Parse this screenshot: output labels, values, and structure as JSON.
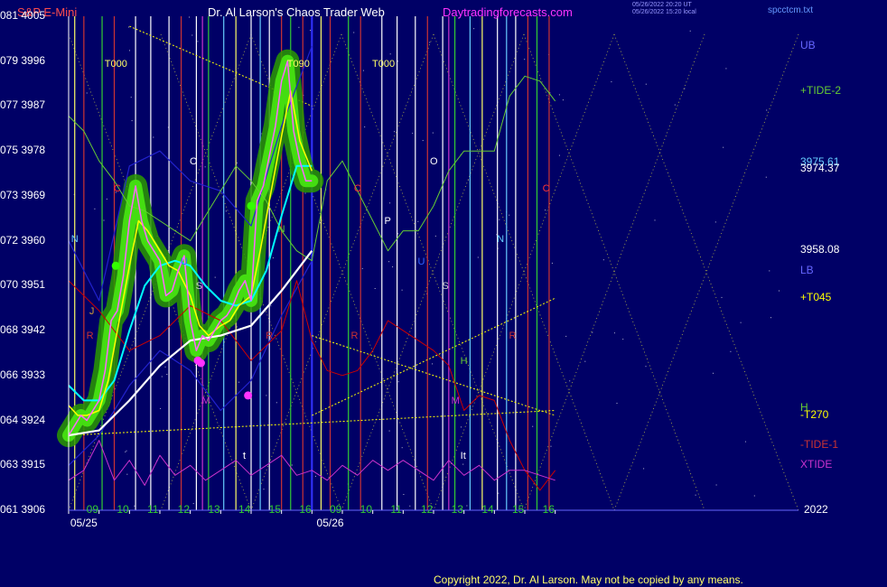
{
  "header": {
    "ticker": "S&P E-Mini",
    "title": "Dr. Al Larson's Chaos Trader Web",
    "url": "Daytradingforecasts.com",
    "timestamp_ut": "05/26/2022 20:20 UT",
    "timestamp_local": "05/26/2022 15:20 local",
    "filename": "spcctcm.txt"
  },
  "footer": {
    "copyright": "Copyright 2022, Dr. Al Larson. May not be copied by any means."
  },
  "colors": {
    "background": "#000066",
    "price": "#ff66ff",
    "fast_ma": "#ffff00",
    "mid_ma": "#00ffff",
    "slow_ma": "#ffffff",
    "green_band": "#33cc00",
    "tide2": "#66cc33",
    "tide1": "#cc0000",
    "xtide": "#cc33cc"
  },
  "chart_data": {
    "type": "line",
    "title": "S&P E-Mini",
    "y_axis": {
      "ylim": [
        3906,
        4005
      ],
      "ticks": [
        {
          "left": "061",
          "value": 3906
        },
        {
          "left": "063",
          "value": 3915
        },
        {
          "left": "064",
          "value": 3924
        },
        {
          "left": "066",
          "value": 3933
        },
        {
          "left": "068",
          "value": 3942
        },
        {
          "left": "070",
          "value": 3951
        },
        {
          "left": "072",
          "value": 3960
        },
        {
          "left": "073",
          "value": 3969
        },
        {
          "left": "075",
          "value": 3978
        },
        {
          "left": "077",
          "value": 3987
        },
        {
          "left": "079",
          "value": 3996
        },
        {
          "left": "081",
          "value": 4005
        }
      ]
    },
    "x_axis": {
      "xlim": [
        8.0,
        32.0
      ],
      "hour_ticks": [
        {
          "t": 9,
          "label": "09"
        },
        {
          "t": 10,
          "label": "10"
        },
        {
          "t": 11,
          "label": "11"
        },
        {
          "t": 12,
          "label": "12"
        },
        {
          "t": 13,
          "label": "13"
        },
        {
          "t": 14,
          "label": "14"
        },
        {
          "t": 15,
          "label": "15"
        },
        {
          "t": 16,
          "label": "16"
        },
        {
          "t": 17,
          "label": "09"
        },
        {
          "t": 18,
          "label": "10"
        },
        {
          "t": 19,
          "label": "11"
        },
        {
          "t": 20,
          "label": "12"
        },
        {
          "t": 21,
          "label": "13"
        },
        {
          "t": 22,
          "label": "14"
        },
        {
          "t": 23,
          "label": "15"
        },
        {
          "t": 24,
          "label": "16"
        }
      ],
      "date_labels": [
        {
          "t": 8.5,
          "label": "05/25"
        },
        {
          "t": 16.6,
          "label": "05/26"
        }
      ],
      "year_label": "2022"
    },
    "right_labels": [
      {
        "text": "UB",
        "y": 3999,
        "color": "#6666ff"
      },
      {
        "text": "+TIDE-2",
        "y": 3990,
        "color": "#66cc33"
      },
      {
        "text": "3975.61",
        "y": 3975.6,
        "color": "#66ccff"
      },
      {
        "text": "3974.37",
        "y": 3974.4,
        "color": "#ffffff"
      },
      {
        "text": "3958.08",
        "y": 3958.1,
        "color": "#ffffff"
      },
      {
        "text": "LB",
        "y": 3954,
        "color": "#6666ff"
      },
      {
        "text": "+T045",
        "y": 3948.5,
        "color": "#ffff00"
      },
      {
        "text": "H",
        "y": 3926.5,
        "color": "#66cc33"
      },
      {
        "text": "-T270",
        "y": 3925.0,
        "color": "#ffff00"
      },
      {
        "text": "-TIDE-1",
        "y": 3919,
        "color": "#cc3333"
      },
      {
        "text": "XTIDE",
        "y": 3915,
        "color": "#cc33cc"
      }
    ],
    "point_labels": [
      {
        "text": "T000",
        "t": 9.3,
        "y": 3995,
        "color": "#ffff66"
      },
      {
        "text": "T090",
        "t": 15.3,
        "y": 3995,
        "color": "#ffff66"
      },
      {
        "text": "T000",
        "t": 18.1,
        "y": 3995,
        "color": "#ffff66"
      },
      {
        "text": "O",
        "t": 12.1,
        "y": 3975.5,
        "color": "#ffffff"
      },
      {
        "text": "O",
        "t": 20.0,
        "y": 3975.5,
        "color": "#ffffff"
      },
      {
        "text": "C",
        "t": 9.6,
        "y": 3970,
        "color": "#ff3333"
      },
      {
        "text": "C",
        "t": 17.5,
        "y": 3970,
        "color": "#ff3333"
      },
      {
        "text": "C",
        "t": 23.7,
        "y": 3970,
        "color": "#ff3333"
      },
      {
        "text": "P",
        "t": 18.5,
        "y": 3963.5,
        "color": "#ffffff"
      },
      {
        "text": "N",
        "t": 8.2,
        "y": 3960,
        "color": "#66ccff"
      },
      {
        "text": "N",
        "t": 22.2,
        "y": 3960,
        "color": "#66ccff"
      },
      {
        "text": "N",
        "t": 15.0,
        "y": 3962,
        "color": "#66cc33"
      },
      {
        "text": "U",
        "t": 11.8,
        "y": 3955.5,
        "color": "#3366ff"
      },
      {
        "text": "U",
        "t": 19.6,
        "y": 3955.5,
        "color": "#3366ff"
      },
      {
        "text": "S",
        "t": 12.3,
        "y": 3950.5,
        "color": "#cccccc"
      },
      {
        "text": "S",
        "t": 20.4,
        "y": 3950.5,
        "color": "#cccccc"
      },
      {
        "text": "J",
        "t": 8.8,
        "y": 3945.5,
        "color": "#cc9933"
      },
      {
        "text": "R",
        "t": 8.7,
        "y": 3940.5,
        "color": "#cc3333"
      },
      {
        "text": "R",
        "t": 14.6,
        "y": 3940.5,
        "color": "#cc3333"
      },
      {
        "text": "R",
        "t": 17.4,
        "y": 3940.5,
        "color": "#cc3333"
      },
      {
        "text": "R",
        "t": 22.6,
        "y": 3940.5,
        "color": "#cc3333"
      },
      {
        "text": "H",
        "t": 21.0,
        "y": 3935.5,
        "color": "#66cc33"
      },
      {
        "text": "M",
        "t": 12.5,
        "y": 3927.5,
        "color": "#cc33cc"
      },
      {
        "text": "M",
        "t": 20.7,
        "y": 3927.5,
        "color": "#cc33cc"
      },
      {
        "text": "t",
        "t": 13.85,
        "y": 3916.5,
        "color": "#ffffff"
      },
      {
        "text": "It",
        "t": 21.0,
        "y": 3916.5,
        "color": "#ffffff"
      }
    ],
    "series": [
      {
        "name": "price",
        "color": "#ff66ff",
        "x": [
          8.0,
          8.2,
          8.4,
          8.6,
          8.8,
          9.0,
          9.2,
          9.4,
          9.6,
          9.8,
          10.0,
          10.2,
          10.4,
          10.6,
          10.8,
          11.0,
          11.2,
          11.4,
          11.6,
          11.8,
          12.0,
          12.2,
          12.4,
          12.6,
          12.8,
          13.0,
          13.2,
          13.4,
          13.6,
          13.8,
          14.0,
          14.2,
          14.4,
          14.6,
          14.8,
          15.0,
          15.2,
          15.4,
          15.6,
          15.8,
          16.0
        ],
        "y": [
          3921,
          3923,
          3925,
          3924,
          3926,
          3928,
          3934,
          3944,
          3946,
          3953,
          3964,
          3971,
          3964,
          3960,
          3958,
          3956,
          3949,
          3950,
          3954,
          3957,
          3944,
          3938,
          3941,
          3940,
          3942,
          3944,
          3945,
          3947,
          3950,
          3952,
          3948,
          3968,
          3971,
          3977,
          3983,
          3992,
          3996,
          3982,
          3976,
          3972,
          3972
        ]
      },
      {
        "name": "fast-ma",
        "color": "#ffff00",
        "x": [
          8.0,
          8.3,
          8.6,
          9.0,
          9.3,
          9.6,
          10.0,
          10.3,
          10.6,
          11.0,
          11.3,
          11.6,
          12.0,
          12.3,
          12.6,
          13.0,
          13.3,
          13.6,
          14.0,
          14.3,
          14.6,
          15.0,
          15.3,
          15.6,
          16.0
        ],
        "y": [
          3927,
          3925,
          3925,
          3926,
          3932,
          3942,
          3955,
          3964,
          3962,
          3958,
          3955,
          3954,
          3949,
          3943,
          3941,
          3943,
          3944,
          3947,
          3949,
          3958,
          3968,
          3981,
          3990,
          3980,
          3974
        ]
      },
      {
        "name": "mid-ma",
        "color": "#00ffff",
        "x": [
          8.0,
          8.5,
          9.0,
          9.5,
          10.0,
          10.5,
          11.0,
          11.5,
          12.0,
          12.5,
          13.0,
          13.5,
          14.0,
          14.5,
          15.0,
          15.5,
          16.0
        ],
        "y": [
          3931,
          3928,
          3928,
          3932,
          3942,
          3951,
          3955,
          3956,
          3955,
          3951,
          3948,
          3947,
          3948,
          3954,
          3965,
          3975,
          3975
        ]
      },
      {
        "name": "slow-ma",
        "color": "#ffffff",
        "x": [
          8.0,
          9.0,
          10.0,
          11.0,
          12.0,
          13.0,
          14.0,
          15.0,
          16.0
        ],
        "y": [
          3921,
          3922,
          3928,
          3935,
          3940,
          3941,
          3943,
          3950,
          3958
        ]
      },
      {
        "name": "+TIDE-2",
        "color": "#66cc33",
        "x": [
          8.0,
          8.5,
          9.0,
          9.5,
          10.0,
          10.5,
          11.0,
          11.5,
          12.0,
          12.5,
          13.0,
          13.5,
          14.0,
          14.5,
          15.0,
          15.5,
          16.0,
          16.5,
          17.0,
          17.5,
          18.0,
          18.5,
          19.0,
          19.5,
          20.0,
          20.5,
          21.0,
          21.5,
          22.0,
          22.5,
          23.0,
          23.5,
          24.0
        ],
        "y": [
          3985,
          3982,
          3976,
          3972,
          3967,
          3966,
          3964,
          3962,
          3960,
          3965,
          3970,
          3975,
          3972,
          3968,
          3962,
          3958,
          3956,
          3972,
          3976,
          3970,
          3964,
          3958,
          3962,
          3962,
          3967,
          3974,
          3978,
          3978,
          3978,
          3989,
          3993,
          3992,
          3988
        ]
      },
      {
        "name": "-TIDE-1",
        "color": "#cc0000",
        "x": [
          8.0,
          9.0,
          10.0,
          11.0,
          12.0,
          13.0,
          14.0,
          15.0,
          15.5,
          16.0,
          16.5,
          17.0,
          17.5,
          18.0,
          18.5,
          19.0,
          19.5,
          20.0,
          20.5,
          21.0,
          21.5,
          22.0,
          22.5,
          23.0,
          23.5,
          24.0
        ],
        "y": [
          3952,
          3946,
          3938,
          3941,
          3947,
          3944,
          3936,
          3942,
          3952,
          3940,
          3934,
          3933,
          3934,
          3938,
          3944,
          3942,
          3940,
          3938,
          3935,
          3926,
          3929,
          3928,
          3920,
          3914,
          3910,
          3914
        ]
      },
      {
        "name": "XTIDE",
        "color": "#cc33cc",
        "x": [
          8.0,
          8.5,
          9.0,
          9.5,
          10.0,
          10.5,
          11.0,
          11.5,
          12.0,
          12.5,
          13.0,
          13.5,
          14.0,
          14.5,
          15.0,
          15.5,
          16.0,
          16.5,
          17.0,
          17.5,
          18.0,
          18.5,
          19.0,
          19.5,
          20.0,
          20.5,
          21.0,
          21.5,
          22.0,
          22.5,
          23.0,
          23.5,
          24.0
        ],
        "y": [
          3912,
          3914,
          3920,
          3912,
          3916,
          3911,
          3917,
          3913,
          3915,
          3912,
          3914,
          3916,
          3913,
          3915,
          3917,
          3913,
          3914,
          3912,
          3915,
          3913,
          3916,
          3914,
          3916,
          3914,
          3912,
          3916,
          3913,
          3915,
          3912,
          3914,
          3914,
          3913,
          3912
        ]
      },
      {
        "name": "upper-band",
        "color": "#2222cc",
        "x": [
          8.0,
          9.0,
          10.0,
          11.0,
          12.0,
          13.0,
          14.0,
          15.0,
          16.0
        ],
        "y": [
          3960,
          3948,
          3975,
          3978,
          3972,
          3970,
          3963,
          3983,
          3999
        ]
      },
      {
        "name": "lower-band",
        "color": "#2222cc",
        "x": [
          8.0,
          9.0,
          10.0,
          11.0,
          12.0,
          13.0,
          14.0,
          15.0,
          16.0
        ],
        "y": [
          3915,
          3921,
          3931,
          3938,
          3934,
          3926,
          3932,
          3945,
          3956
        ]
      }
    ],
    "cycle_lines": [
      {
        "t": 8.2,
        "color": "#ffff66"
      },
      {
        "t": 8.5,
        "color": "#cc3333"
      },
      {
        "t": 9.1,
        "color": "#33cc33"
      },
      {
        "t": 9.5,
        "color": "#cc3333"
      },
      {
        "t": 10.2,
        "color": "#ffffff"
      },
      {
        "t": 10.7,
        "color": "#ffffff"
      },
      {
        "t": 11.3,
        "color": "#ffffff"
      },
      {
        "t": 11.7,
        "color": "#cc3333"
      },
      {
        "t": 12.2,
        "color": "#ffffff"
      },
      {
        "t": 12.4,
        "color": "#cc33cc"
      },
      {
        "t": 12.6,
        "color": "#33cc33"
      },
      {
        "t": 13.1,
        "color": "#66ccff"
      },
      {
        "t": 13.5,
        "color": "#ffff66"
      },
      {
        "t": 14.0,
        "color": "#ffffff"
      },
      {
        "t": 14.3,
        "color": "#66ccff"
      },
      {
        "t": 14.6,
        "color": "#ffffff"
      },
      {
        "t": 15.0,
        "color": "#cc3333"
      },
      {
        "t": 15.3,
        "color": "#33cc33"
      },
      {
        "t": 15.7,
        "color": "#cc3333"
      },
      {
        "t": 16.0,
        "color": "#ffffff"
      },
      {
        "t": 16.3,
        "color": "#ffff66"
      },
      {
        "t": 16.6,
        "color": "#cc3333"
      },
      {
        "t": 17.2,
        "color": "#33cc33"
      },
      {
        "t": 17.6,
        "color": "#cc3333"
      },
      {
        "t": 18.3,
        "color": "#ffffff"
      },
      {
        "t": 18.8,
        "color": "#ffffff"
      },
      {
        "t": 19.4,
        "color": "#ffffff"
      },
      {
        "t": 19.8,
        "color": "#cc3333"
      },
      {
        "t": 20.3,
        "color": "#ffffff"
      },
      {
        "t": 20.5,
        "color": "#cc33cc"
      },
      {
        "t": 20.7,
        "color": "#33cc33"
      },
      {
        "t": 21.2,
        "color": "#66ccff"
      },
      {
        "t": 21.6,
        "color": "#ffff66"
      },
      {
        "t": 22.1,
        "color": "#ffffff"
      },
      {
        "t": 22.4,
        "color": "#66ccff"
      },
      {
        "t": 22.7,
        "color": "#ffffff"
      },
      {
        "t": 23.1,
        "color": "#cc3333"
      },
      {
        "t": 23.4,
        "color": "#33cc33"
      },
      {
        "t": 23.8,
        "color": "#cc3333"
      }
    ],
    "trend_lines": [
      {
        "name": "+T045",
        "color": "#ffff00",
        "x": [
          16.0,
          24.0
        ],
        "y": [
          3925,
          3948.5
        ]
      },
      {
        "name": "-T270",
        "color": "#ffff00",
        "x": [
          16.0,
          24.0
        ],
        "y": [
          3941,
          3925.0
        ]
      },
      {
        "name": "upper-trend",
        "color": "#ffff00",
        "x": [
          10.0,
          16.0
        ],
        "y": [
          4003,
          3987
        ]
      },
      {
        "name": "base-line",
        "color": "#ffff00",
        "x": [
          8.0,
          24.0
        ],
        "y": [
          3921,
          3926
        ]
      }
    ],
    "markers": [
      {
        "t": 9.55,
        "y": 3955,
        "color": "#33ff00"
      },
      {
        "t": 14.0,
        "y": 3967,
        "color": "#33ff00"
      },
      {
        "t": 12.25,
        "y": 3936,
        "color": "#ff33ff"
      },
      {
        "t": 12.35,
        "y": 3935.5,
        "color": "#ff33ff"
      },
      {
        "t": 13.9,
        "y": 3929,
        "color": "#ff33ff"
      }
    ]
  }
}
